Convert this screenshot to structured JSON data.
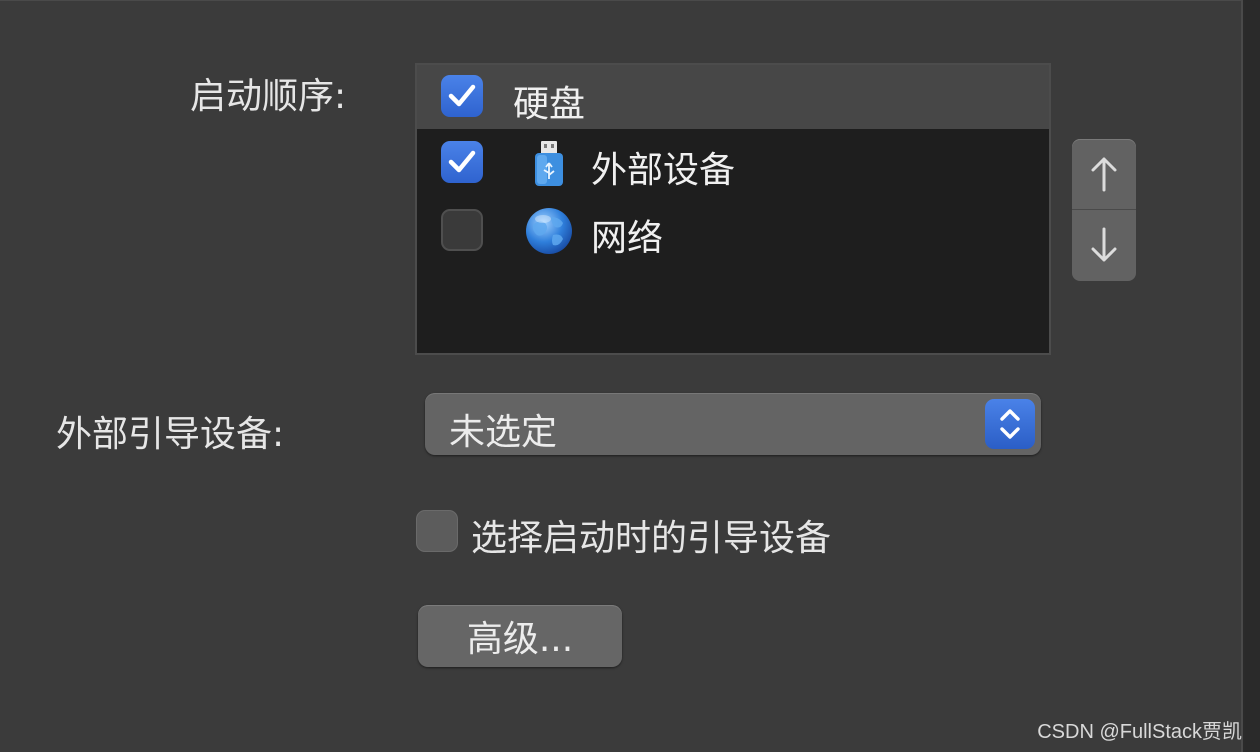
{
  "boot": {
    "order_label": "启动顺序:",
    "items": [
      {
        "label": "硬盘",
        "checked": true,
        "selected": true,
        "icon": ""
      },
      {
        "label": "外部设备",
        "checked": true,
        "selected": false,
        "icon": "usb-drive-icon"
      },
      {
        "label": "网络",
        "checked": false,
        "selected": false,
        "icon": "globe-icon"
      }
    ]
  },
  "stepper": {
    "up_icon": "arrow-up-icon",
    "down_icon": "arrow-down-icon"
  },
  "external_boot": {
    "label": "外部引导设备:",
    "selected_value": "未选定"
  },
  "select_at_boot": {
    "label": "选择启动时的引导设备",
    "checked": false
  },
  "advanced_button": "高级...",
  "watermark": "CSDN @FullStack贾凯",
  "colors": {
    "accent": "#3b74de",
    "panel_bg": "#3b3b3b",
    "list_bg": "#1e1e1e"
  }
}
